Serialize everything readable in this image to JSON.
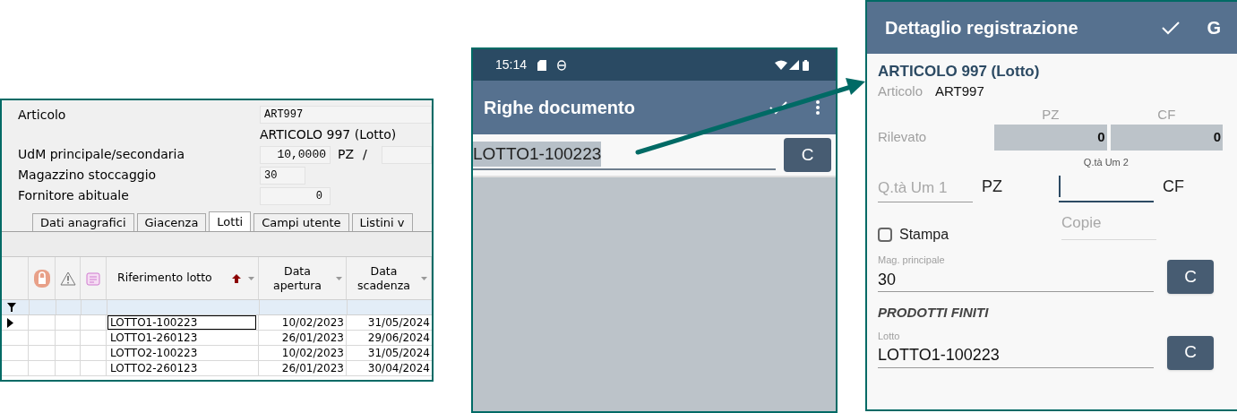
{
  "desktop_window": {
    "article": {
      "label": "Articolo",
      "code": "ART997",
      "description": "ARTICOLO 997 (Lotto)"
    },
    "units": {
      "label": "UdM principale/secondaria",
      "conversion": "10,0000",
      "unit": "PZ",
      "separator": "/"
    },
    "warehouse": {
      "label": "Magazzino stoccaggio",
      "value": "30"
    },
    "supplier": {
      "label": "Fornitore abituale",
      "value": "0"
    },
    "tabs": [
      {
        "label": "Dati anagrafici",
        "selected": false
      },
      {
        "label": "Giacenza",
        "selected": false
      },
      {
        "label": "Lotti",
        "selected": true
      },
      {
        "label": "Campi utente",
        "selected": false
      },
      {
        "label": "Listini v",
        "selected": false
      }
    ],
    "table": {
      "columns": [
        "Riferimento lotto",
        "Data apertura",
        "Data scadenza"
      ],
      "rows": [
        {
          "lot": "LOTTO1-100223",
          "opened": "10/02/2023",
          "expires": "31/05/2024",
          "selected": true
        },
        {
          "lot": "LOTTO1-260123",
          "opened": "26/01/2023",
          "expires": "29/06/2024",
          "selected": false
        },
        {
          "lot": "LOTTO2-100223",
          "opened": "10/02/2023",
          "expires": "31/05/2024",
          "selected": false
        },
        {
          "lot": "LOTTO2-260123",
          "opened": "26/01/2023",
          "expires": "30/04/2024",
          "selected": false
        }
      ]
    }
  },
  "document_lines_screen": {
    "status_bar": {
      "time": "15:14"
    },
    "title": "Righe documento",
    "scan_field": {
      "value": "LOTTO1-100223",
      "text_selected": true
    },
    "clear_button": "C"
  },
  "detail_screen": {
    "title": "Dettaglio registrazione",
    "action": "G",
    "item_title": "ARTICOLO 997 (Lotto)",
    "article_label": "Articolo",
    "article_code": "ART997",
    "count": {
      "label": "Rilevato",
      "columns": [
        {
          "unit": "PZ",
          "value": "0"
        },
        {
          "unit": "CF",
          "value": "0"
        }
      ]
    },
    "quantities": [
      {
        "label": "Q.tà Um 1",
        "unit": "PZ",
        "focused": false
      },
      {
        "label": "Q.tà Um 2",
        "unit": "CF",
        "focused": true
      }
    ],
    "print": {
      "label": "Stampa",
      "checked": false
    },
    "copies": {
      "placeholder": "Copie"
    },
    "warehouse": {
      "label": "Mag. principale",
      "value": "30",
      "button": "C"
    },
    "section": "PRODOTTI FINITI",
    "lot": {
      "label": "Lotto",
      "value": "LOTTO1-100223",
      "button": "C"
    }
  }
}
